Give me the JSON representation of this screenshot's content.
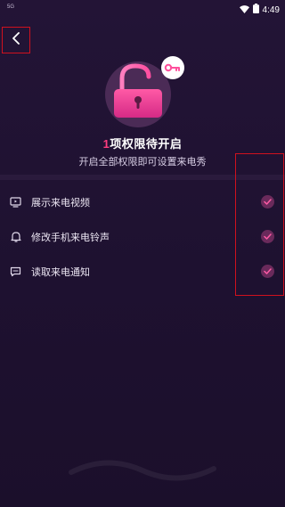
{
  "status_bar": {
    "network": "5G",
    "time": "4:49"
  },
  "permission_header": {
    "count": "1",
    "title_suffix": "项权限待开启",
    "subtitle": "开启全部权限即可设置来电秀"
  },
  "permissions": [
    {
      "label": "展示来电视频",
      "icon": "tv-icon",
      "granted": true
    },
    {
      "label": "修改手机来电铃声",
      "icon": "bell-icon",
      "granted": true
    },
    {
      "label": "读取来电通知",
      "icon": "message-icon",
      "granted": true
    }
  ],
  "colors": {
    "background": "#1f1230",
    "accent": "#ff3d7f",
    "check_bg": "#6a2a5b",
    "annotation": "#d0111e"
  }
}
